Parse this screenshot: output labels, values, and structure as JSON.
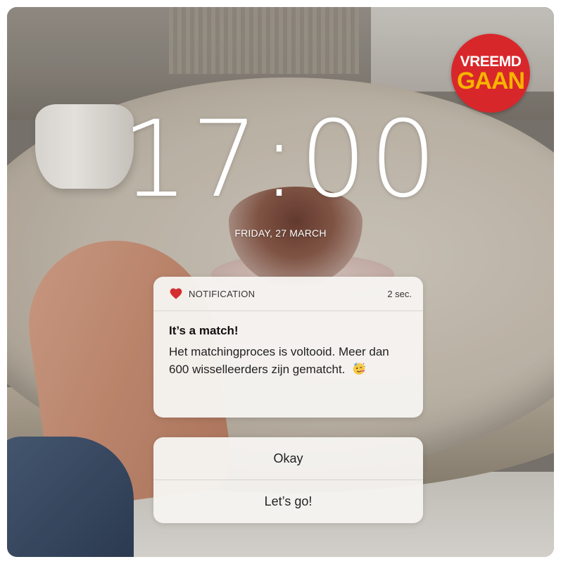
{
  "logo": {
    "line1": "VREEMD",
    "line2": "GAAN",
    "color": "#d8272b"
  },
  "lockscreen": {
    "time": "17:00",
    "date": "FRIDAY, 27 MARCH"
  },
  "notification": {
    "icon": "heart-icon",
    "icon_color": "#d32f2f",
    "label": "NOTIFICATION",
    "time": "2 sec.",
    "title": "It’s a match!",
    "message": "Het matchingproces is voltooid. Meer dan 600 wisselleerders zijn gematcht.",
    "emoji": "partying-face-emoji"
  },
  "actions": [
    {
      "label": "Okay"
    },
    {
      "label": "Let’s go!"
    }
  ]
}
